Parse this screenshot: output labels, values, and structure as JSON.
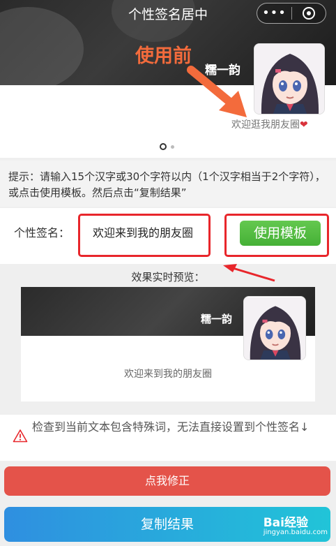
{
  "header": {
    "title": "个性签名居中",
    "more_icon": "more-dots-icon",
    "close_icon": "capsule-close-icon"
  },
  "banner": {
    "before_label": "使用前",
    "nickname": "糯一韵",
    "welcome": "欢迎逛我朋友圈",
    "heart": "❤"
  },
  "tip": {
    "text": "提示：请输入15个汉字或30个字符以内（1个汉字相当于2个字符），或点击使用模板。然后点击“复制结果”"
  },
  "form": {
    "label": "个性签名：",
    "value": "欢迎来到我的朋友圈",
    "template_button": "使用模板"
  },
  "preview": {
    "caption": "效果实时预览：",
    "nickname": "糯一韵",
    "welcome": "欢迎来到我的朋友圈"
  },
  "warning": {
    "text": "检查到当前文本包含特殊词，无法直接设置到个性签名↓"
  },
  "actions": {
    "fix_button": "点我修正",
    "copy_button": "复制结果"
  },
  "watermark": {
    "brand": "Bai经验",
    "url": "jingyan.baidu.com"
  },
  "colors": {
    "accent_orange": "#f36b3c",
    "annotation_red": "#e8262b",
    "green": "#4cb83a",
    "fix_red": "#e4534a",
    "copy_blue": "#2f8fe0"
  }
}
